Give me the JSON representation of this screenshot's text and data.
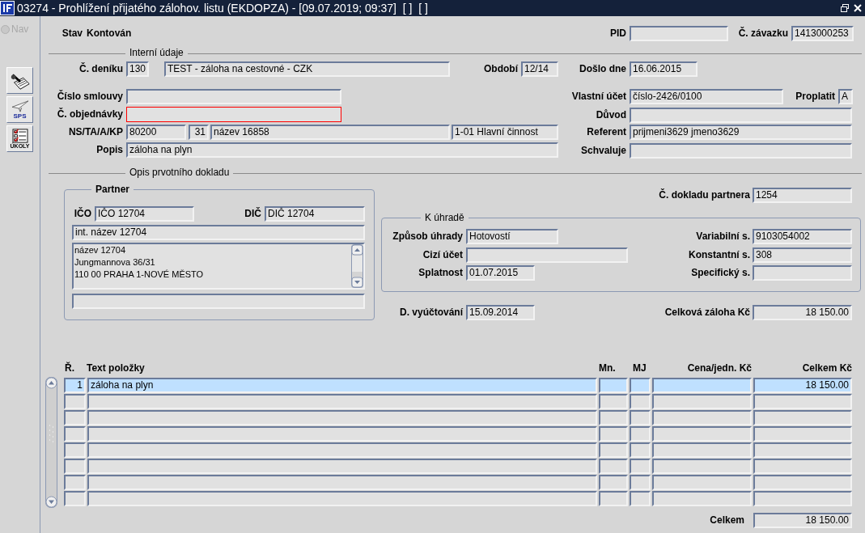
{
  "window": {
    "title": "03274 - Prohlížení přijatého zálohov. listu (EKDOPZA) - [09.07.2019; 09:37]  [ ]  [ ]"
  },
  "nav": {
    "label": "Nav",
    "disabled": true
  },
  "toolbar": [
    {
      "kind": "sign"
    },
    {
      "kind": "sps",
      "label": "SPS"
    },
    {
      "kind": "tasks",
      "label": "ÚKOLY"
    }
  ],
  "header": {
    "status_label": "Stav",
    "status": "Kontován",
    "fields": [
      {
        "label": "PID"
      },
      {
        "label": "Č. závazku",
        "value": "1413000253"
      }
    ]
  },
  "internal": {
    "title": "Interní údaje",
    "fields": [
      {
        "label": "Č. deníku",
        "value": "130",
        "invalid": false
      },
      {
        "value": "TEST - záloha na cestovné - CZK",
        "invalid": false
      },
      {
        "label": "Období",
        "value": "12/14",
        "invalid": false
      },
      {
        "label": "Došlo dne",
        "value": "16.06.2015",
        "invalid": false
      },
      {
        "label": "Číslo smlouvy",
        "invalid": false
      },
      {
        "label": "Vlastní účet",
        "value": "číslo-2426/0100",
        "invalid": false
      },
      {
        "label": "Proplatit",
        "value": "A",
        "invalid": false
      },
      {
        "label": "Č. objednávky",
        "invalid": true
      },
      {
        "label": "Důvod",
        "invalid": false
      },
      {
        "label": "NS/TA/A/KP",
        "value": "80200",
        "invalid": false
      },
      {
        "value": "31",
        "invalid": false
      },
      {
        "value": "název 16858",
        "invalid": false
      },
      {
        "value": "1-01 Hlavní činnost",
        "invalid": false
      },
      {
        "label": "Referent",
        "value": "prijmeni3629 jmeno3629",
        "invalid": false
      },
      {
        "label": "Popis",
        "value": "záloha na plyn",
        "invalid": false
      },
      {
        "label": "Schvaluje",
        "invalid": false
      }
    ]
  },
  "origin": {
    "title": "Opis prvotního dokladu",
    "partner": {
      "title": "Partner",
      "fields": [
        {
          "label": "IČO",
          "value": "IČO 12704"
        },
        {
          "label": "DIČ",
          "value": "DIČ 12704"
        },
        {
          "value": "int. název 12704"
        }
      ],
      "address": [
        "název 12704",
        "Jungmannova 36/31",
        "110 00 PRAHA 1-NOVÉ MĚSTO"
      ]
    },
    "partner_document": {
      "label": "Č. dokladu partnera",
      "value": "1254"
    },
    "payment": {
      "title": "K úhradě",
      "fields": [
        {
          "label": "Způsob úhrady",
          "value": "Hotovostí"
        },
        {
          "label": "Variabilní s.",
          "value": "9103054002"
        },
        {
          "label": "Cizí účet"
        },
        {
          "label": "Konstantní s.",
          "value": "308"
        },
        {
          "label": "Splatnost",
          "value": "01.07.2015"
        },
        {
          "label": "Specifický s."
        }
      ]
    },
    "settlement": [
      {
        "label": "D. vyúčtování",
        "value": "15.09.2014"
      },
      {
        "label": "Celková záloha Kč",
        "value": "18 150.00"
      }
    ]
  },
  "table": {
    "columns": [
      "Ř.",
      "Text položky",
      "Mn.",
      "MJ",
      "Cena/jedn. Kč",
      "Celkem Kč"
    ],
    "rows": [
      {
        "selected": true,
        "number": "1",
        "text": "záloha na plyn",
        "total": "18 150.00"
      },
      {
        "selected": false
      },
      {
        "selected": false
      },
      {
        "selected": false
      },
      {
        "selected": false
      },
      {
        "selected": false
      },
      {
        "selected": false
      },
      {
        "selected": false
      }
    ]
  },
  "footer": {
    "label": "Celkem",
    "value": "18 150.00"
  }
}
